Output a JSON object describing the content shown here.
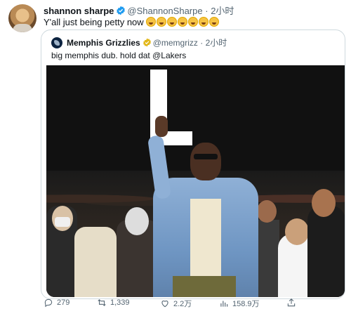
{
  "tweet": {
    "author_name": "shannon sharpe",
    "author_handle": "@ShannonSharpe",
    "separator": "·",
    "time": "2小时",
    "text": "Y'all just being petty now",
    "emoji_count": 7,
    "emoji": "rolling-on-floor-laughing"
  },
  "quoted": {
    "author_name": "Memphis Grizzlies",
    "author_handle": "@memgrizz",
    "separator": "·",
    "time": "2小时",
    "text": "big memphis dub. hold dat @Lakers",
    "media_overlay_text": "L"
  },
  "actions": {
    "replies": "279",
    "retweets": "1,339",
    "likes": "2.2万",
    "views": "158.9万"
  },
  "colors": {
    "verified_blue": "#1d9bf0",
    "verified_gold": "#e2b719",
    "secondary_text": "#536471",
    "border": "#cfd9de"
  }
}
